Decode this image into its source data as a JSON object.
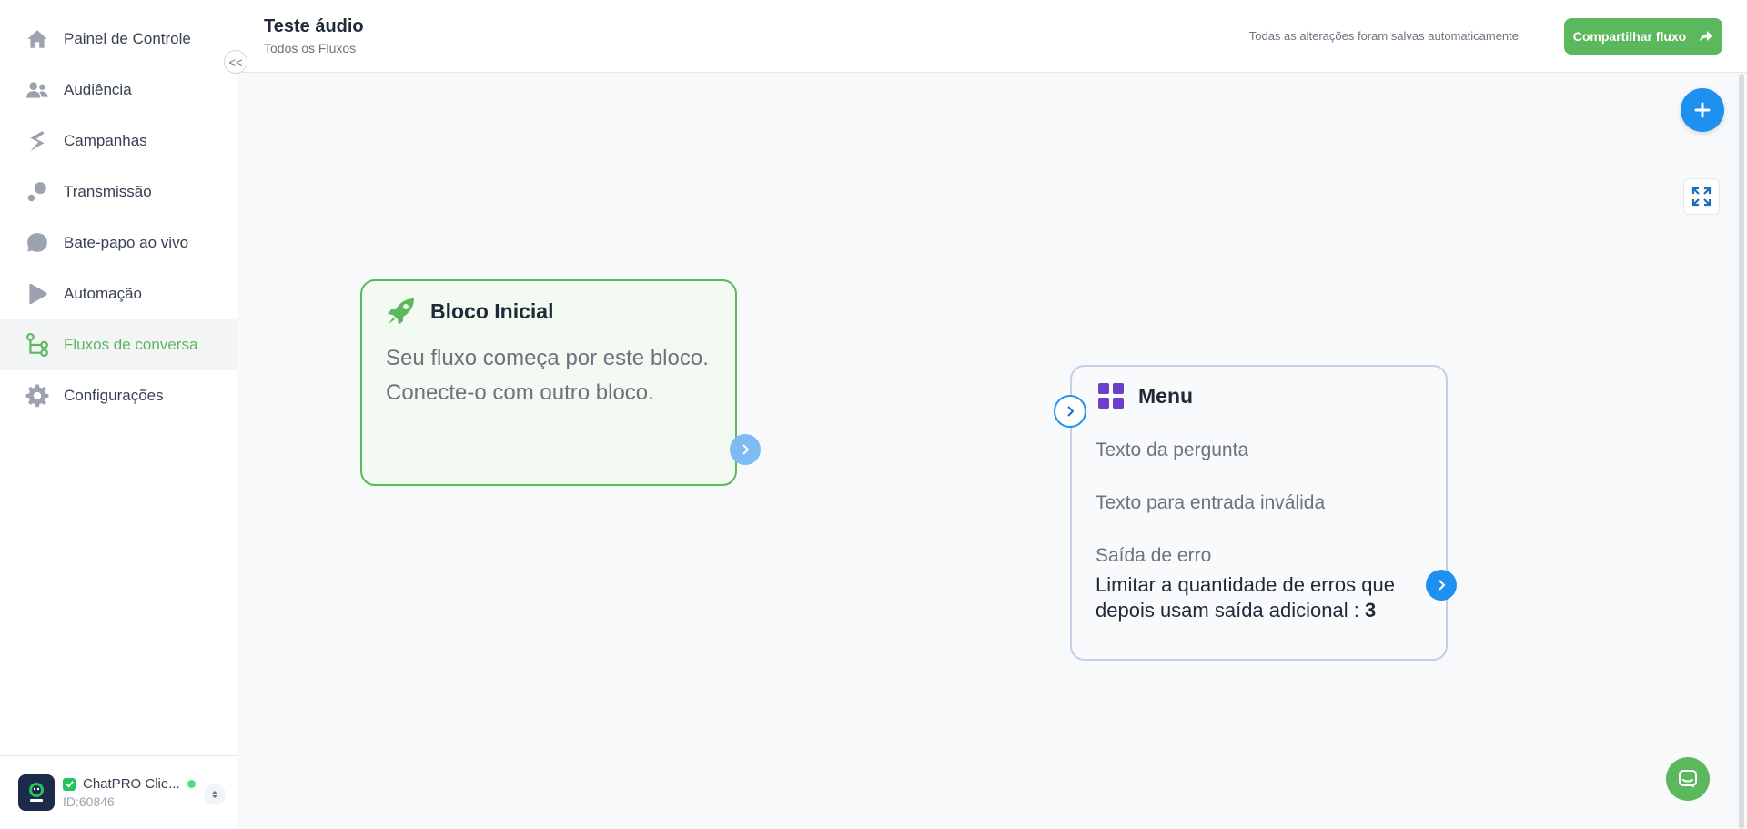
{
  "sidebar": {
    "items": [
      {
        "label": "Painel de Controle",
        "icon": "home-icon"
      },
      {
        "label": "Audiência",
        "icon": "users-icon"
      },
      {
        "label": "Campanhas",
        "icon": "campaign-icon"
      },
      {
        "label": "Transmissão",
        "icon": "broadcast-icon"
      },
      {
        "label": "Bate-papo ao vivo",
        "icon": "chat-bubble-icon"
      },
      {
        "label": "Automação",
        "icon": "automation-icon"
      },
      {
        "label": "Fluxos de conversa",
        "icon": "flow-icon",
        "active": true
      },
      {
        "label": "Configurações",
        "icon": "gear-icon"
      }
    ],
    "collapse_label": "<<",
    "account": {
      "name": "ChatPRO Clie...",
      "id": "ID:60846",
      "status_color": "#4ade80"
    }
  },
  "header": {
    "title": "Teste áudio",
    "breadcrumb": "Todos os Fluxos",
    "save_status": "Todas as alterações foram salvas automaticamente",
    "share_label": "Compartilhar fluxo"
  },
  "canvas": {
    "start_block": {
      "title": "Bloco Inicial",
      "description": "Seu fluxo começa por este bloco. Conecte-o com outro bloco."
    },
    "menu_block": {
      "title": "Menu",
      "question_text": "Texto da pergunta",
      "invalid_text": "Texto para entrada inválida",
      "error_output": "Saída de erro",
      "limit_text": "Limitar a quantidade de erros que depois usam saída adicional :",
      "limit_value": "3"
    }
  },
  "colors": {
    "accent_green": "#5cb85c",
    "accent_blue": "#1e90f0",
    "menu_icon": "#6b3fc9"
  }
}
